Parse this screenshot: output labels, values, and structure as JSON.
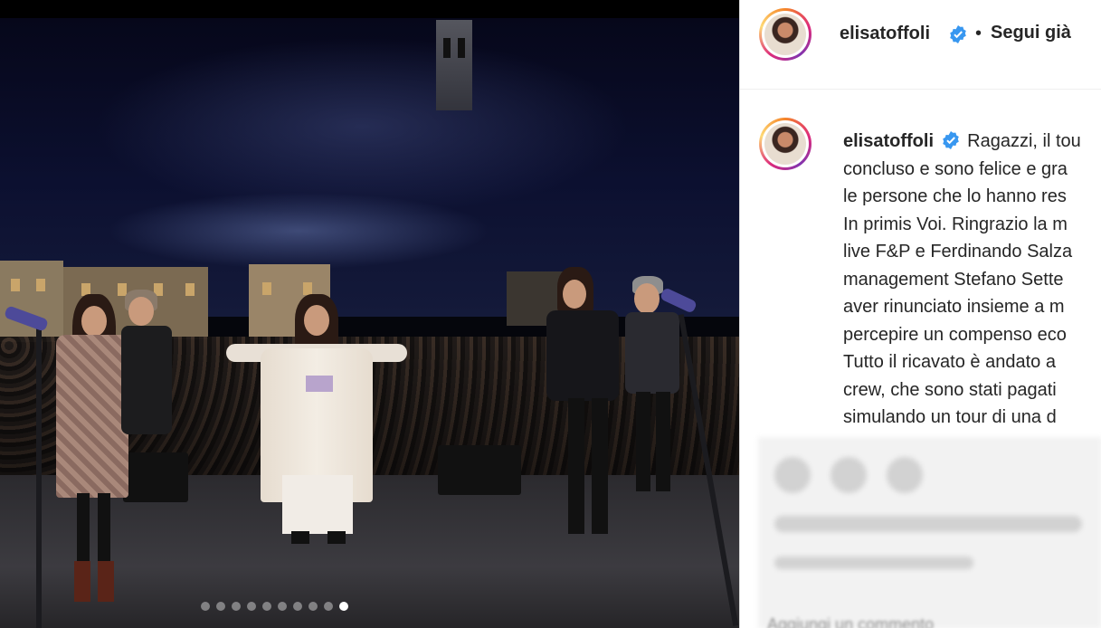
{
  "post": {
    "username": "elisatoffoli",
    "separator": "•",
    "follow_label": "Segui già",
    "caption_lines": [
      "Ragazzi, il tou",
      "concluso e sono felice e gra",
      "le persone che lo hanno res",
      "In primis Voi. Ringrazio la m",
      "live F&P e Ferdinando Salza",
      "management Stefano Sette",
      "aver rinunciato insieme a m",
      "percepire un compenso eco",
      "Tutto il ricavato è andato a",
      "crew, che sono stati pagati",
      "simulando un tour di una d"
    ],
    "bottom_blurred_text": "Aggiungi un commento"
  },
  "carousel": {
    "total": 10,
    "active_index": 9
  },
  "colors": {
    "verified": "#3897f0",
    "text": "#262626",
    "border": "#dbdbdb"
  }
}
